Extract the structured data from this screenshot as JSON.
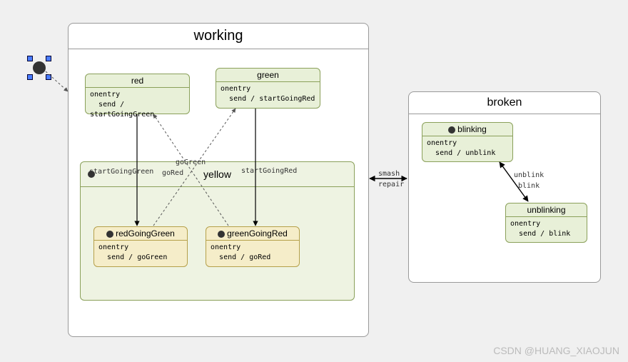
{
  "working": {
    "title": "working",
    "children": {
      "red": {
        "title": "red",
        "entry": "onentry",
        "action": "send / startGoingGreen"
      },
      "green": {
        "title": "green",
        "entry": "onentry",
        "action": "send / startGoingRed"
      },
      "yellow": {
        "title": "yellow",
        "children": {
          "redGoingGreen": {
            "title": "redGoingGreen",
            "entry": "onentry",
            "action": "send / goGreen"
          },
          "greenGoingRed": {
            "title": "greenGoingRed",
            "entry": "onentry",
            "action": "send / goRed"
          }
        }
      }
    }
  },
  "broken": {
    "title": "broken",
    "children": {
      "blinking": {
        "title": "blinking",
        "entry": "onentry",
        "action": "send / unblink"
      },
      "unblinking": {
        "title": "unblinking",
        "entry": "onentry",
        "action": "send / blink"
      }
    }
  },
  "transitions": {
    "startGoingGreen": "startGoingGreen",
    "startGoingRed": "startGoingRed",
    "goGreen": "goGreen",
    "goRed": "goRed",
    "smash": "smash",
    "repair": "repair",
    "unblink": "unblink",
    "blink": "blink"
  },
  "watermark": "CSDN @HUANG_XIAOJUN"
}
